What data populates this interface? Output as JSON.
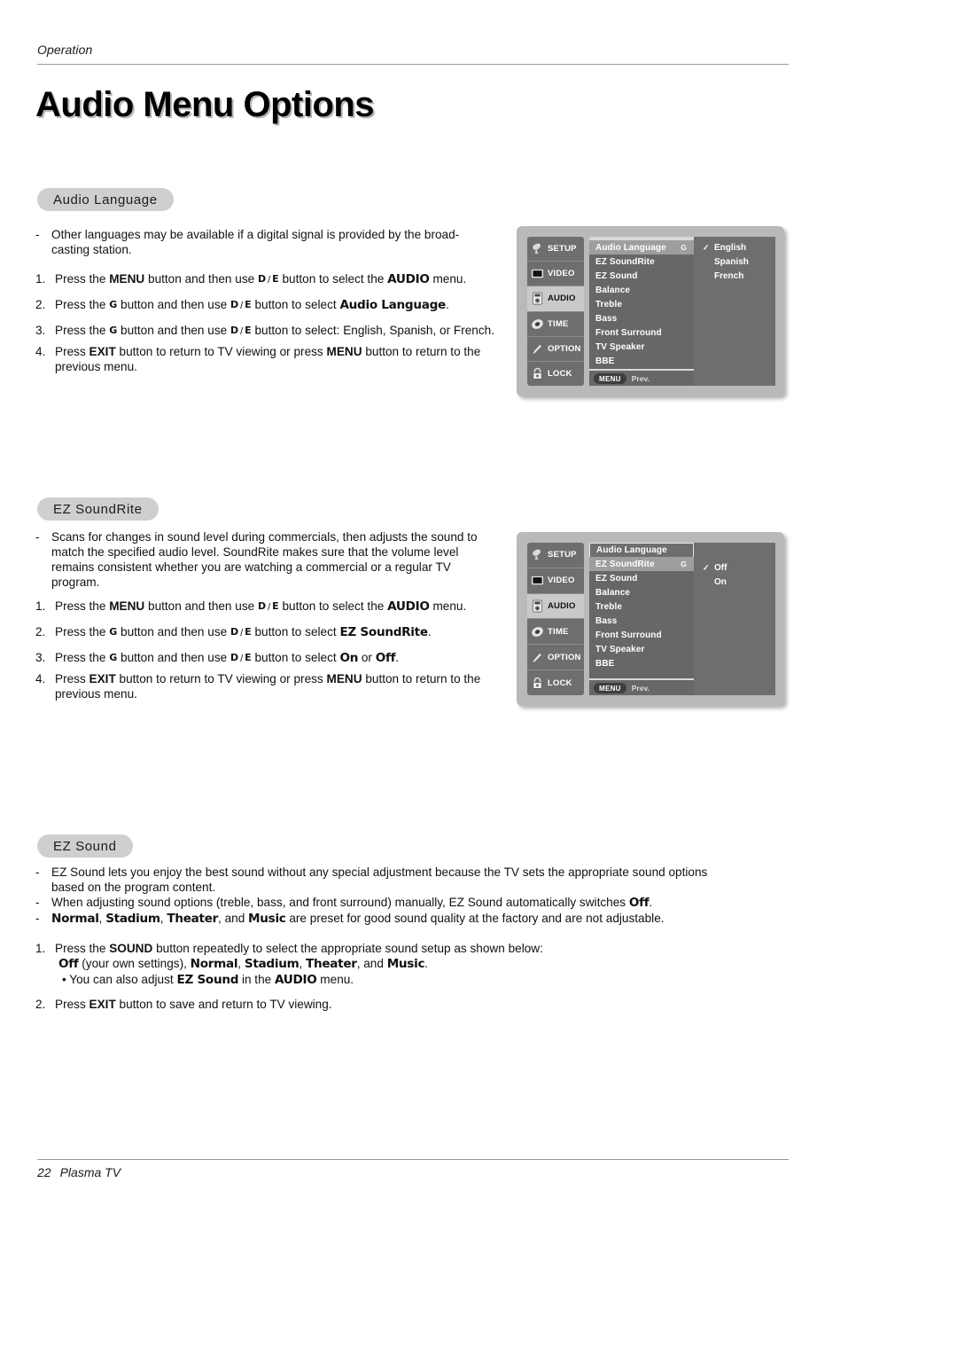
{
  "header": {
    "running_head": "Operation"
  },
  "title": "Audio Menu Options",
  "footer": {
    "page_number": "22",
    "label": "Plasma TV"
  },
  "keys": {
    "down": "D",
    "sep": "/",
    "up": "E",
    "right": "G"
  },
  "sections": [
    {
      "heading": "Audio Language",
      "bullets": [
        "Other languages may be available if a digital signal is provided by the broad-casting station."
      ],
      "steps": [
        {
          "n": "1.",
          "parts": [
            "Press the ",
            "MENU",
            " button and then use ",
            "KEYS_DE",
            " button to select the ",
            "AUDIO",
            " menu."
          ]
        },
        {
          "n": "2.",
          "parts": [
            "Press the ",
            "KEY_G",
            " button and then use ",
            "KEYS_DE",
            " button to select ",
            "Audio Language",
            "."
          ]
        },
        {
          "n": "3.",
          "parts": [
            "Press the ",
            "KEY_G",
            " button and then use ",
            "KEYS_DE",
            " button to select: English, Spanish, or French."
          ]
        },
        {
          "n": "4.",
          "parts": [
            "Press ",
            "EXIT",
            " button to return to TV viewing or press ",
            "MENU",
            " button to return to the previous menu."
          ]
        }
      ]
    },
    {
      "heading": "EZ SoundRite",
      "bullets": [
        "Scans for changes in sound level during commercials, then adjusts the sound to match the specified audio level. SoundRite makes sure that the volume level remains consistent whether you are watching a commercial or a regular TV program."
      ]
    },
    {
      "heading": "EZ Sound"
    }
  ],
  "s1": {
    "bullet1_a": "Other languages may be available if a digital signal is provided by the broad-",
    "bullet1_b": "casting station.",
    "step1": {
      "n": "1.",
      "t1": "Press the ",
      "b1": "MENU",
      "t2": " button and then use ",
      "t3": " button to select the ",
      "b2": "AUDIO",
      "t4": " menu."
    },
    "step2": {
      "n": "2.",
      "t1": "Press the ",
      "t2": " button and then use ",
      "t3": " button to select ",
      "b1": "Audio Language",
      "t4": "."
    },
    "step3": {
      "n": "3.",
      "t1": "Press the ",
      "t2": " button and then use ",
      "t3": " button to select: English, Spanish, or French."
    },
    "step4": {
      "n": "4.",
      "t1": "Press ",
      "b1": "EXIT",
      "t2": " button to return to TV viewing or press ",
      "b2": "MENU",
      "t3": " button to return to the previous menu."
    }
  },
  "s2": {
    "bullet1": "Scans for changes in sound level during commercials, then adjusts the sound to match the specified audio level. SoundRite makes sure that the volume level remains consistent whether you are watching a commercial or a regular TV program.",
    "step1": {
      "n": "1.",
      "t1": "Press the ",
      "b1": "MENU",
      "t2": " button and then use ",
      "t3": " button to select the ",
      "b2": "AUDIO",
      "t4": " menu."
    },
    "step2": {
      "n": "2.",
      "t1": "Press the ",
      "t2": " button and then use ",
      "t3": " button to select ",
      "b1": "EZ SoundRite",
      "t4": "."
    },
    "step3": {
      "n": "3.",
      "t1": "Press the ",
      "t2": " button and then use ",
      "t3": " button to select ",
      "b1": "On",
      "t4": " or ",
      "b2": "Off",
      "t5": "."
    },
    "step4": {
      "n": "4.",
      "t1": "Press ",
      "b1": "EXIT",
      "t2": " button to return to TV viewing or press ",
      "b2": "MENU",
      "t3": " button to return to the previous menu."
    }
  },
  "s3": {
    "bullet1": "EZ Sound lets you enjoy the best sound without any special adjustment because the TV sets the appropriate sound options based on the program content.",
    "bullet2": {
      "t1": "When adjusting sound options (treble, bass, and front surround) manually, EZ Sound automatically switches ",
      "b1": "Off",
      "t2": "."
    },
    "bullet3": {
      "b1": "Normal",
      "t1": ", ",
      "b2": "Stadium",
      "t2": ", ",
      "b3": "Theater",
      "t3": ", and ",
      "b4": "Music",
      "t4": " are preset for good sound quality at the factory and are not adjustable."
    },
    "step1": {
      "n": "1.",
      "t1": "Press the ",
      "b1": "SOUND",
      "t2": " button repeatedly to select the appropriate sound setup as shown below:"
    },
    "step1_line2": {
      "b1": "Off",
      "t1": " (your own settings), ",
      "b2": "Normal",
      "t2": ", ",
      "b3": "Stadium",
      "t3": ", ",
      "b4": "Theater",
      "t4": ", and ",
      "b5": "Music",
      "t5": "."
    },
    "step1_line3": {
      "t0": "• You can also adjust ",
      "b1": "EZ Sound",
      "t1": " in the ",
      "b2": "AUDIO",
      "t2": " menu."
    },
    "step2": {
      "n": "2.",
      "t1": "Press ",
      "b1": "EXIT",
      "t2": " button to save and return to TV viewing."
    }
  },
  "osd": {
    "rail": [
      {
        "label": "SETUP",
        "icon": "satellite-dish-icon",
        "active": false
      },
      {
        "label": "VIDEO",
        "icon": "tv-screen-icon",
        "active": false
      },
      {
        "label": "AUDIO",
        "icon": "speaker-icon",
        "active": true
      },
      {
        "label": "TIME",
        "icon": "clock-icon",
        "active": false
      },
      {
        "label": "OPTION",
        "icon": "wrench-icon",
        "active": false
      },
      {
        "label": "LOCK",
        "icon": "padlock-icon",
        "active": false
      }
    ],
    "menu_items": [
      "Audio Language",
      "EZ SoundRite",
      "EZ Sound",
      "Balance",
      "Treble",
      "Bass",
      "Front Surround",
      "TV Speaker",
      "BBE"
    ],
    "footer_chip": "MENU",
    "footer_label": "Prev.",
    "arrow_glyph": "G",
    "check_glyph": "✓",
    "screen1": {
      "selected_index": 0,
      "options": [
        {
          "label": "English",
          "checked": true
        },
        {
          "label": "Spanish",
          "checked": false
        },
        {
          "label": "French",
          "checked": false
        }
      ]
    },
    "screen2": {
      "selected_index": 1,
      "options": [
        {
          "label": "Off",
          "checked": true
        },
        {
          "label": "On",
          "checked": false
        }
      ]
    }
  },
  "colors": {
    "pill_bg": "#cfcfcf",
    "osd_frame": "#b9b9b9",
    "osd_rail": "#6e6e6e",
    "osd_panel": "#676767",
    "osd_highlight": "#9e9e9e",
    "rail_active": "#c9c9c9",
    "rule": "#9a9a9a"
  }
}
